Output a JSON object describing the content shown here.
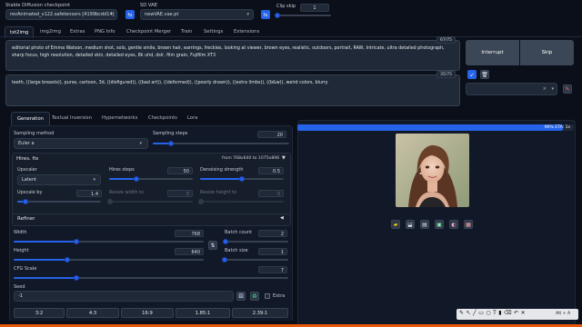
{
  "header": {
    "checkpoint_label": "Stable Diffusion checkpoint",
    "checkpoint_value": "revAnimated_v122.safetensors [4199bcdd14]",
    "vae_label": "SD VAE",
    "vae_value": "newVAE.vae.pt",
    "clip_skip_label": "Clip skip",
    "clip_skip_value": "1"
  },
  "tabs": [
    "txt2img",
    "img2img",
    "Extras",
    "PNG Info",
    "Checkpoint Merger",
    "Train",
    "Settings",
    "Extensions"
  ],
  "prompt": {
    "text": "editorial photo of Emma Watson, medium shot, solo, gentle smile, brown hair, earrings, freckles, looking at viewer, brown eyes, realistic, outdoors, portrait, RAW, Intricate, ultra detailed photograph, sharp focus, high resolution, detailed skin, detailed eyes, 8k uhd, dslr, film grain, Fujifilm XT3",
    "token_count": "67/75"
  },
  "negative": {
    "text": "teeth, ((large breasts)), purse, cartoon, 3d, ((disfigured)), ((bad art)), ((deformed)), ((poorly drawn)), ((extra limbs)), ((b&w)), weird colors, blurry",
    "token_count": "35/75"
  },
  "actions": {
    "interrupt": "Interrupt",
    "skip": "Skip"
  },
  "subtabs": [
    "Generation",
    "Textual Inversion",
    "Hypernetworks",
    "Checkpoints",
    "Lora"
  ],
  "sampling": {
    "method_label": "Sampling method",
    "method_value": "Euler a",
    "steps_label": "Sampling steps",
    "steps_value": "20",
    "steps_fraction": 0.13
  },
  "hires": {
    "title": "Hires. fix",
    "from_text": "from 768x640 to 1075x896",
    "upscaler_label": "Upscaler",
    "upscaler_value": "Latent",
    "steps_label": "Hires steps",
    "steps_value": "50",
    "steps_fraction": 0.33,
    "denoise_label": "Denoising strength",
    "denoise_value": "0.5",
    "denoise_fraction": 0.5,
    "upscale_label": "Upscale by",
    "upscale_value": "1.4",
    "upscale_fraction": 0.1,
    "resize_w_label": "Resize width to",
    "resize_w_value": "0",
    "resize_h_label": "Resize height to",
    "resize_h_value": "0"
  },
  "refiner": {
    "title": "Refiner"
  },
  "dims": {
    "width_label": "Width",
    "width_value": "768",
    "width_fraction": 0.33,
    "height_label": "Height",
    "height_value": "640",
    "height_fraction": 0.28,
    "batch_count_label": "Batch count",
    "batch_count_value": "2",
    "batch_count_fraction": 0.01,
    "batch_size_label": "Batch size",
    "batch_size_value": "1",
    "batch_size_fraction": 0.0,
    "cfg_label": "CFG Scale",
    "cfg_value": "7",
    "cfg_fraction": 0.23
  },
  "seed": {
    "label": "Seed",
    "value": "-1",
    "extra_label": "Extra"
  },
  "aspect_ratios": [
    "3:2",
    "4:3",
    "16:9",
    "1.85:1",
    "2.39:1"
  ],
  "progress": {
    "text": "96% ETA: 1s",
    "fraction": 0.96
  },
  "bottom_toolbar": {
    "hint": "Alt + A"
  },
  "colors": {
    "accent": "#2563eb",
    "background": "#0b0f19",
    "panel": "#111827",
    "interrupt": "#3b4656"
  }
}
